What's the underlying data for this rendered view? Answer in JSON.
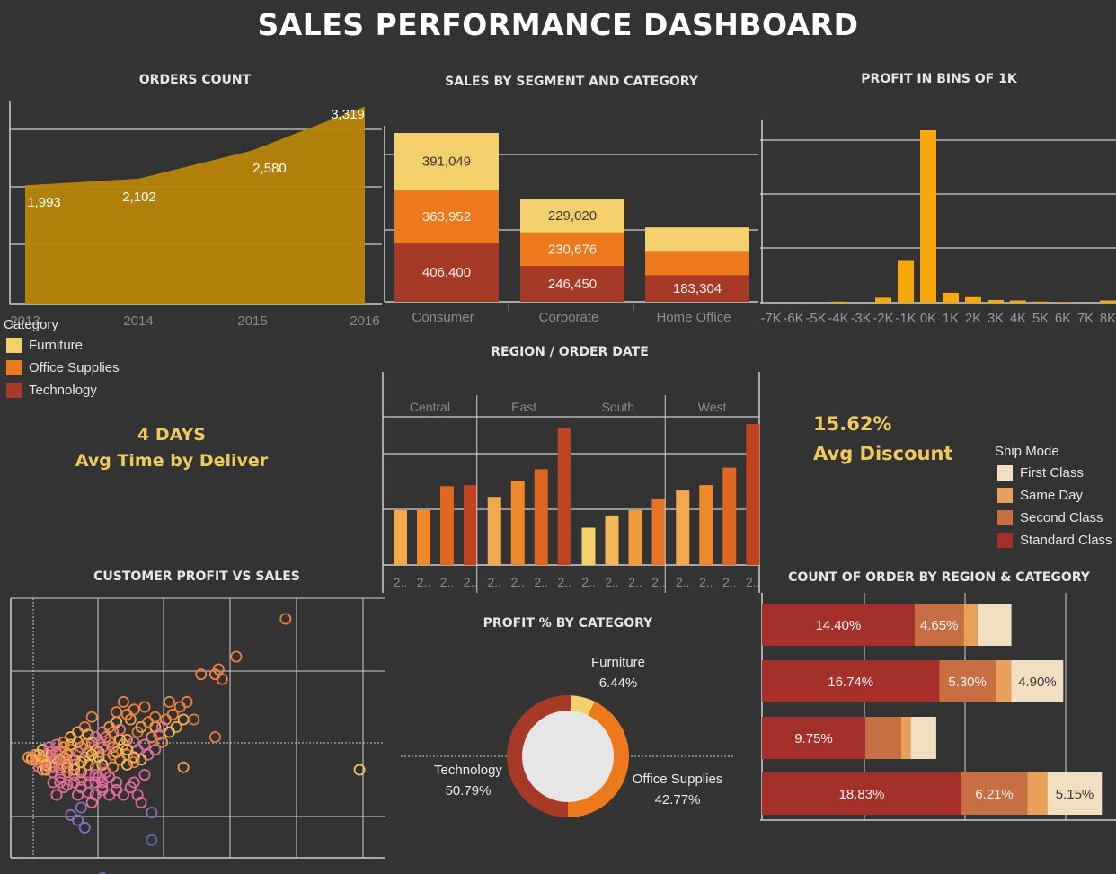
{
  "title": "SALES PERFORMANCE DASHBOARD",
  "colors": {
    "background": "#333333",
    "furniture": "#f3d06b",
    "office_supplies": "#ec7a1c",
    "technology": "#a73a26",
    "area": "#b8860b",
    "bins": "#f7a90c",
    "first_class": "#f2dfc2",
    "same_day": "#e8a15a",
    "second_class": "#c76e42",
    "standard_class": "#a5302b",
    "kpi": "#f0c95b"
  },
  "orders_count": {
    "title": "ORDERS COUNT",
    "chart_data": {
      "type": "area",
      "x": [
        "2013",
        "2014",
        "2015",
        "2016"
      ],
      "values": [
        1993,
        2102,
        2580,
        3319
      ],
      "labels": [
        "1,993",
        "2,102",
        "2,580",
        "3,319"
      ]
    }
  },
  "sales_segment": {
    "title": "SALES BY SEGMENT AND CATEGORY",
    "chart_data": {
      "type": "bar",
      "stacked": true,
      "categories": [
        "Consumer",
        "Corporate",
        "Home Office"
      ],
      "series": [
        {
          "name": "Technology",
          "values": [
            406400,
            246450,
            183304
          ],
          "labels": [
            "406,400",
            "246,450",
            "183,304"
          ]
        },
        {
          "name": "Office Supplies",
          "values": [
            363952,
            230676,
            166000
          ],
          "labels": [
            "363,952",
            "230,676",
            ""
          ]
        },
        {
          "name": "Furniture",
          "values": [
            391049,
            229020,
            162000
          ],
          "labels": [
            "391,049",
            "229,020",
            ""
          ]
        }
      ]
    }
  },
  "profit_bins": {
    "title": "PROFIT IN BINS OF 1K",
    "chart_data": {
      "type": "bar",
      "categories": [
        "-7K",
        "-6K",
        "-5K",
        "-4K",
        "-3K",
        "-2K",
        "-1K",
        "0K",
        "1K",
        "2K",
        "3K",
        "4K",
        "5K",
        "6K",
        "7K",
        "8K"
      ],
      "values": [
        0,
        0,
        0,
        2,
        0,
        9,
        75,
        310,
        18,
        10,
        5,
        4,
        2,
        1,
        0,
        4
      ]
    }
  },
  "category_legend": {
    "title": "Category",
    "items": [
      "Furniture",
      "Office Supplies",
      "Technology"
    ]
  },
  "delivery_kpi": {
    "value": "4 DAYS",
    "label": "Avg Time by Deliver"
  },
  "region_date": {
    "title": "REGION / ORDER DATE",
    "chart_data": {
      "type": "bar",
      "panels": [
        {
          "name": "Central",
          "values": [
            103,
            103,
            148,
            150
          ]
        },
        {
          "name": "East",
          "values": [
            128,
            158,
            180,
            258
          ]
        },
        {
          "name": "South",
          "values": [
            70,
            93,
            103,
            125
          ]
        },
        {
          "name": "West",
          "values": [
            140,
            150,
            183,
            265
          ]
        }
      ],
      "tick_label": "2.."
    }
  },
  "discount_kpi": {
    "value": "15.62%",
    "label": "Avg Discount"
  },
  "ship_legend": {
    "title": "Ship Mode",
    "items": [
      "First Class",
      "Same Day",
      "Second Class",
      "Standard Class"
    ]
  },
  "customer_scatter": {
    "title": "CUSTOMER PROFIT VS SALES",
    "chart_data": {
      "type": "scatter",
      "xlim": [
        0,
        100
      ],
      "ylim": [
        0,
        100
      ],
      "points": [
        [
          78,
          95
        ],
        [
          64,
          80
        ],
        [
          59,
          75
        ],
        [
          58,
          73
        ],
        [
          60,
          71
        ],
        [
          54,
          73
        ],
        [
          99,
          35
        ],
        [
          58,
          48
        ],
        [
          49,
          36
        ],
        [
          41,
          52
        ],
        [
          40,
          48
        ],
        [
          38,
          45
        ],
        [
          36,
          43
        ],
        [
          35,
          40
        ],
        [
          33,
          41
        ],
        [
          32,
          45
        ],
        [
          30,
          42
        ],
        [
          29,
          50
        ],
        [
          28,
          46
        ],
        [
          26,
          44
        ],
        [
          25,
          40
        ],
        [
          24,
          43
        ],
        [
          23,
          46
        ],
        [
          22,
          42
        ],
        [
          21,
          40
        ],
        [
          20,
          44
        ],
        [
          19,
          42
        ],
        [
          18,
          39
        ],
        [
          17,
          43
        ],
        [
          16,
          41
        ],
        [
          15,
          40
        ],
        [
          14,
          42
        ],
        [
          13,
          39
        ],
        [
          12,
          41
        ],
        [
          11,
          40
        ],
        [
          10,
          41
        ],
        [
          9,
          40
        ],
        [
          8,
          41
        ],
        [
          7,
          41
        ],
        [
          6,
          40
        ],
        [
          27,
          39
        ],
        [
          26,
          37
        ],
        [
          24,
          36
        ],
        [
          22,
          37
        ],
        [
          20,
          38
        ],
        [
          18,
          37
        ],
        [
          16,
          38
        ],
        [
          14,
          37
        ],
        [
          12,
          36
        ],
        [
          10,
          38
        ],
        [
          31,
          39
        ],
        [
          33,
          37
        ],
        [
          29,
          36
        ],
        [
          27,
          34
        ],
        [
          25,
          32
        ],
        [
          24,
          30
        ],
        [
          22,
          33
        ],
        [
          20,
          34
        ],
        [
          18,
          35
        ],
        [
          16,
          34
        ],
        [
          14,
          35
        ],
        [
          12,
          34
        ],
        [
          10,
          35
        ],
        [
          36,
          50
        ],
        [
          34,
          55
        ],
        [
          30,
          54
        ],
        [
          28,
          52
        ],
        [
          26,
          50
        ],
        [
          24,
          48
        ],
        [
          22,
          49
        ],
        [
          21,
          52
        ],
        [
          19,
          50
        ],
        [
          17,
          48
        ],
        [
          15,
          46
        ],
        [
          13,
          45
        ],
        [
          11,
          44
        ],
        [
          9,
          43
        ],
        [
          14,
          32
        ],
        [
          12,
          30
        ],
        [
          38,
          33
        ],
        [
          35,
          30
        ],
        [
          34,
          28
        ],
        [
          30,
          30
        ],
        [
          28,
          32
        ],
        [
          26,
          30
        ],
        [
          24,
          33
        ],
        [
          22,
          30
        ],
        [
          20,
          31
        ],
        [
          36,
          25
        ],
        [
          40,
          18
        ],
        [
          37,
          22
        ],
        [
          26,
          28
        ],
        [
          18,
          30
        ],
        [
          16,
          29
        ],
        [
          14,
          30
        ],
        [
          30,
          58
        ],
        [
          23,
          56
        ],
        [
          45,
          62
        ],
        [
          48,
          60
        ],
        [
          50,
          62
        ],
        [
          49,
          55
        ],
        [
          44,
          55
        ],
        [
          43,
          52
        ],
        [
          42,
          49
        ],
        [
          41,
          56
        ],
        [
          39,
          54
        ],
        [
          37,
          52
        ],
        [
          35,
          59
        ],
        [
          33,
          57
        ],
        [
          32,
          62
        ],
        [
          38,
          60
        ],
        [
          46,
          57
        ],
        [
          52,
          55
        ],
        [
          47,
          52
        ],
        [
          45,
          50
        ],
        [
          43,
          46
        ],
        [
          41,
          43
        ],
        [
          39,
          41
        ],
        [
          37,
          39
        ],
        [
          35,
          38
        ],
        [
          33,
          47
        ],
        [
          31,
          47
        ],
        [
          29,
          44
        ],
        [
          27,
          43
        ],
        [
          25,
          46
        ],
        [
          23,
          41
        ],
        [
          21,
          45
        ],
        [
          19,
          46
        ],
        [
          17,
          45
        ],
        [
          15,
          44
        ],
        [
          13,
          42
        ],
        [
          11,
          42
        ],
        [
          9,
          39
        ],
        [
          8,
          38
        ],
        [
          7,
          39
        ],
        [
          6,
          39
        ],
        [
          5,
          40
        ],
        [
          12,
          38
        ],
        [
          11,
          36
        ],
        [
          10,
          37
        ],
        [
          13,
          25
        ],
        [
          17,
          17
        ],
        [
          19,
          15
        ],
        [
          20,
          20
        ],
        [
          21,
          12
        ],
        [
          40,
          7
        ],
        [
          26,
          -8
        ],
        [
          23,
          22
        ],
        [
          19,
          25
        ],
        [
          15,
          28
        ],
        [
          9,
          35
        ],
        [
          8,
          36
        ],
        [
          17,
          39
        ],
        [
          16,
          36
        ],
        [
          15,
          37
        ],
        [
          14,
          39
        ],
        [
          18,
          33
        ],
        [
          20,
          28
        ],
        [
          22,
          26
        ],
        [
          24,
          25
        ],
        [
          26,
          27
        ],
        [
          28,
          25
        ],
        [
          30,
          27
        ],
        [
          32,
          25
        ],
        [
          27,
          48
        ],
        [
          31,
          51
        ],
        [
          35,
          46
        ],
        [
          33,
          43
        ],
        [
          29,
          41
        ],
        [
          25,
          42
        ]
      ]
    }
  },
  "profit_pct": {
    "title": "PROFIT % BY CATEGORY",
    "chart_data": {
      "type": "pie",
      "donut": true,
      "slices": [
        {
          "name": "Furniture",
          "value": 6.44,
          "label": "6.44%"
        },
        {
          "name": "Office Supplies",
          "value": 42.77,
          "label": "42.77%"
        },
        {
          "name": "Technology",
          "value": 50.79,
          "label": "50.79%"
        }
      ]
    }
  },
  "count_region": {
    "title": "COUNT OF ORDER BY REGION & CATEGORY",
    "chart_data": {
      "type": "bar",
      "orientation": "horizontal",
      "stacked": true,
      "rows": [
        {
          "values": [
            14.4,
            4.65,
            1.3,
            3.2
          ],
          "labels": [
            "14.40%",
            "4.65%",
            "",
            ""
          ]
        },
        {
          "values": [
            16.74,
            5.3,
            1.5,
            4.9
          ],
          "labels": [
            "16.74%",
            "5.30%",
            "",
            "4.90%"
          ]
        },
        {
          "values": [
            9.75,
            3.4,
            0.9,
            2.4
          ],
          "labels": [
            "9.75%",
            "",
            "",
            ""
          ]
        },
        {
          "values": [
            18.83,
            6.21,
            1.9,
            5.15
          ],
          "labels": [
            "18.83%",
            "6.21%",
            "",
            "5.15%"
          ]
        }
      ]
    }
  }
}
